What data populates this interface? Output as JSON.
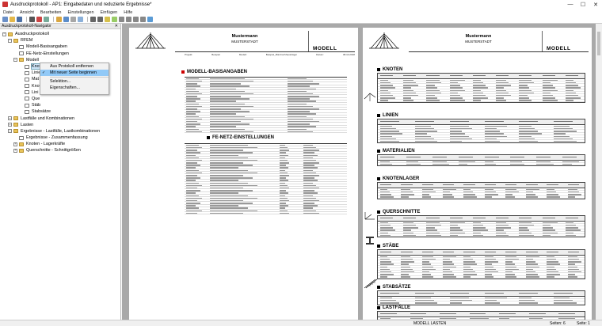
{
  "window": {
    "title": "Ausdruckprotokoll - AP1: Eingabedaten und reduzierte Ergebnisse*",
    "minimize": "—",
    "maximize": "☐",
    "close": "✕"
  },
  "menu": [
    "Datei",
    "Ansicht",
    "Bearbeiten",
    "Einstellungen",
    "Einfügen",
    "Hilfe"
  ],
  "navigator": {
    "title": "Ausdruckprotokoll-Navigator",
    "tree": [
      {
        "label": "Ausdruckprotokoll",
        "level": 0,
        "exp": "−",
        "icon": "folder-icon"
      },
      {
        "label": "RFEM",
        "level": 1,
        "exp": "−",
        "icon": "folder-icon"
      },
      {
        "label": "Modell-Basisangaben",
        "level": 2,
        "exp": "",
        "icon": "document-icon"
      },
      {
        "label": "FE-Netz-Einstellungen",
        "level": 2,
        "exp": "",
        "icon": "document-icon"
      },
      {
        "label": "Modell",
        "level": 2,
        "exp": "−",
        "icon": "folder-icon"
      },
      {
        "label": "Knoten",
        "level": 3,
        "exp": "",
        "icon": "document-icon",
        "selected": true
      },
      {
        "label": "Linie",
        "level": 3,
        "exp": "",
        "icon": "document-icon"
      },
      {
        "label": "Mat",
        "level": 3,
        "exp": "",
        "icon": "document-icon"
      },
      {
        "label": "Knot",
        "level": 3,
        "exp": "",
        "icon": "document-icon"
      },
      {
        "label": "Lini",
        "level": 3,
        "exp": "",
        "icon": "document-icon"
      },
      {
        "label": "Que",
        "level": 3,
        "exp": "",
        "icon": "document-icon"
      },
      {
        "label": "Stäb",
        "level": 3,
        "exp": "",
        "icon": "document-icon"
      },
      {
        "label": "Stabsätze",
        "level": 3,
        "exp": "",
        "icon": "document-icon"
      },
      {
        "label": "Lastfälle und Kombinationen",
        "level": 1,
        "exp": "+",
        "icon": "folder-icon"
      },
      {
        "label": "Lasten",
        "level": 1,
        "exp": "+",
        "icon": "folder-icon"
      },
      {
        "label": "Ergebnisse - Lastfälle, Lastkombinationen",
        "level": 1,
        "exp": "−",
        "icon": "folder-icon"
      },
      {
        "label": "Ergebnisse - Zusammenfassung",
        "level": 2,
        "exp": "",
        "icon": "document-icon"
      },
      {
        "label": "Knoten - Lagerkräfte",
        "level": 2,
        "exp": "+",
        "icon": "folder-icon"
      },
      {
        "label": "Querschnitte - Schnittgrößen",
        "level": 2,
        "exp": "+",
        "icon": "folder-icon"
      }
    ]
  },
  "context_menu": {
    "items": [
      {
        "label": "Aus Protokoll entfernen",
        "checked": false,
        "highlighted": false
      },
      {
        "label": "Mit neuer Seite beginnen",
        "checked": true,
        "highlighted": true
      },
      {
        "label": "Selektion...",
        "checked": false,
        "highlighted": false
      },
      {
        "label": "Eigenschaften...",
        "checked": false,
        "highlighted": false
      }
    ]
  },
  "pages": {
    "header": {
      "company": "Mustermann",
      "city": "MUSTERSTADT",
      "model": "MODELL",
      "project_label": "Projekt:",
      "project_value": "Beispiel",
      "model_label": "Modell:",
      "model_value": "Beispiel_Bürohochhausträger",
      "date_label": "Datum:",
      "date_value": "08.10.2018"
    },
    "left_sections": [
      "MODELL-BASISANGABEN",
      "FE-NETZ-EINSTELLUNGEN"
    ],
    "right_sections": [
      "KNOTEN",
      "LINIEN",
      "MATERIALIEN",
      "KNOTENLAGER",
      "QUERSCHNITTE",
      "STÄBE",
      "STABSÄTZE",
      "LASTFÄLLE"
    ]
  },
  "status": {
    "mode": "MODELL LASTEN",
    "pages_label": "Seiten: 6",
    "page_label": "Seite: 1"
  },
  "colors": {
    "preview_bg": "#a9a9a9",
    "highlight": "#91c9f7",
    "section_bullet": "#c00000"
  }
}
